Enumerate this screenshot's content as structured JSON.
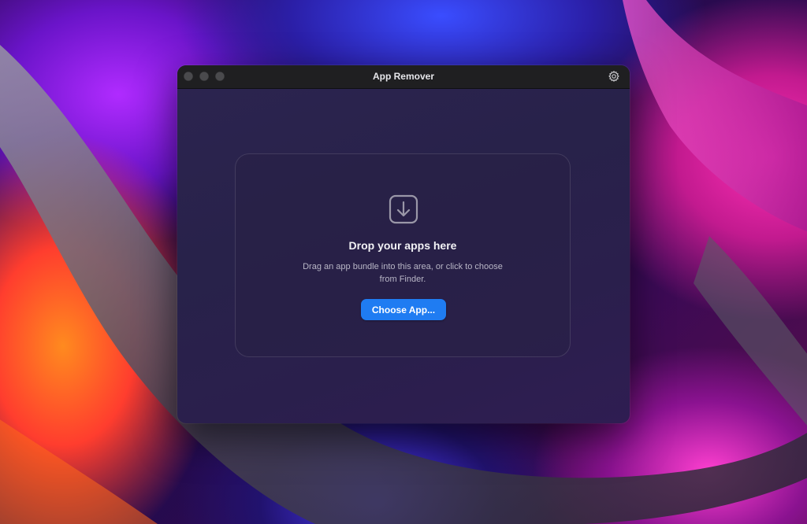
{
  "window": {
    "title": "App Remover"
  },
  "toolbar": {
    "settings_icon": "gear-icon"
  },
  "dropzone": {
    "icon": "download-arrow-icon",
    "title": "Drop your apps here",
    "description": "Drag an app bundle into this area, or click to choose from Finder.",
    "button_label": "Choose App..."
  },
  "colors": {
    "accent": "#1f7cf2",
    "titlebar": "#1f1f21",
    "window_bg": "#2a2250"
  }
}
